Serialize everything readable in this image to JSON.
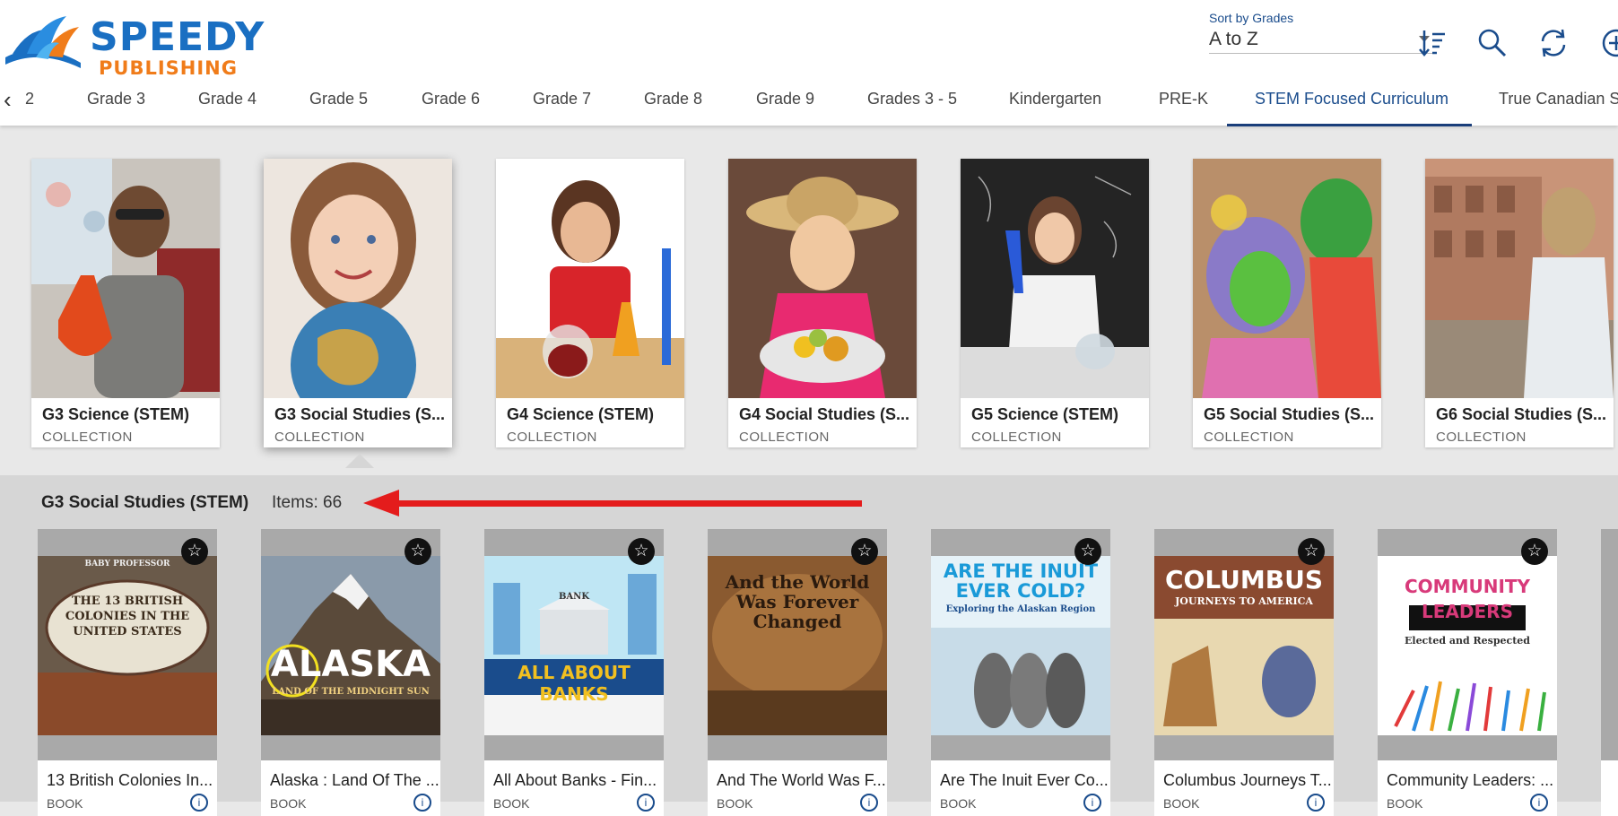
{
  "brand": {
    "line1": "SPEEDY",
    "line2": "PUBLISHING"
  },
  "sort": {
    "label": "Sort by Grades",
    "value": "A to Z"
  },
  "toolbar": {
    "icons": [
      "sort-icon",
      "search-icon",
      "refresh-icon",
      "add-icon"
    ]
  },
  "tabs": {
    "prev_arrow": "‹",
    "partial": "2",
    "items": [
      "Grade 3",
      "Grade 4",
      "Grade 5",
      "Grade 6",
      "Grade 7",
      "Grade 8",
      "Grade 9",
      "Grades 3 - 5",
      "Kindergarten",
      "PRE-K",
      "STEM Focused Curriculum",
      "True Canadian S"
    ],
    "active": "STEM Focused Curriculum"
  },
  "collections": [
    {
      "title": "G3 Science (STEM)",
      "type": "COLLECTION"
    },
    {
      "title": "G3 Social Studies (S...",
      "type": "COLLECTION"
    },
    {
      "title": "G4 Science (STEM)",
      "type": "COLLECTION"
    },
    {
      "title": "G4 Social Studies (S...",
      "type": "COLLECTION"
    },
    {
      "title": "G5 Science (STEM)",
      "type": "COLLECTION"
    },
    {
      "title": "G5 Social Studies (S...",
      "type": "COLLECTION"
    },
    {
      "title": "G6 Social Studies (S...",
      "type": "COLLECTION"
    }
  ],
  "detail": {
    "title": "G3 Social Studies (STEM)",
    "count": "Items: 66"
  },
  "books": [
    {
      "title": "13 British Colonies In...",
      "type": "BOOK",
      "cover_top": "BABY PROFESSOR",
      "cover_main": "THE 13 BRITISH COLONIES IN THE UNITED STATES"
    },
    {
      "title": "Alaska : Land Of The ...",
      "type": "BOOK",
      "cover_main": "ALASKA",
      "cover_sub": "LAND OF THE MIDNIGHT SUN"
    },
    {
      "title": "All About Banks - Fin...",
      "type": "BOOK",
      "cover_main": "ALL ABOUT BANKS",
      "cover_sub": "BANK"
    },
    {
      "title": "And The World Was F...",
      "type": "BOOK",
      "cover_main": "And the World Was Forever Changed"
    },
    {
      "title": "Are The Inuit Ever Co...",
      "type": "BOOK",
      "cover_main": "ARE THE INUIT EVER COLD?",
      "cover_sub": "Exploring the Alaskan Region"
    },
    {
      "title": "Columbus Journeys T...",
      "type": "BOOK",
      "cover_main": "COLUMBUS",
      "cover_sub": "JOURNEYS TO AMERICA"
    },
    {
      "title": "Community Leaders: ...",
      "type": "BOOK",
      "cover_main": "COMMUNITY LEADERS",
      "cover_sub": "Elected and Respected"
    }
  ],
  "icons": {
    "star": "☆",
    "info": "i"
  }
}
